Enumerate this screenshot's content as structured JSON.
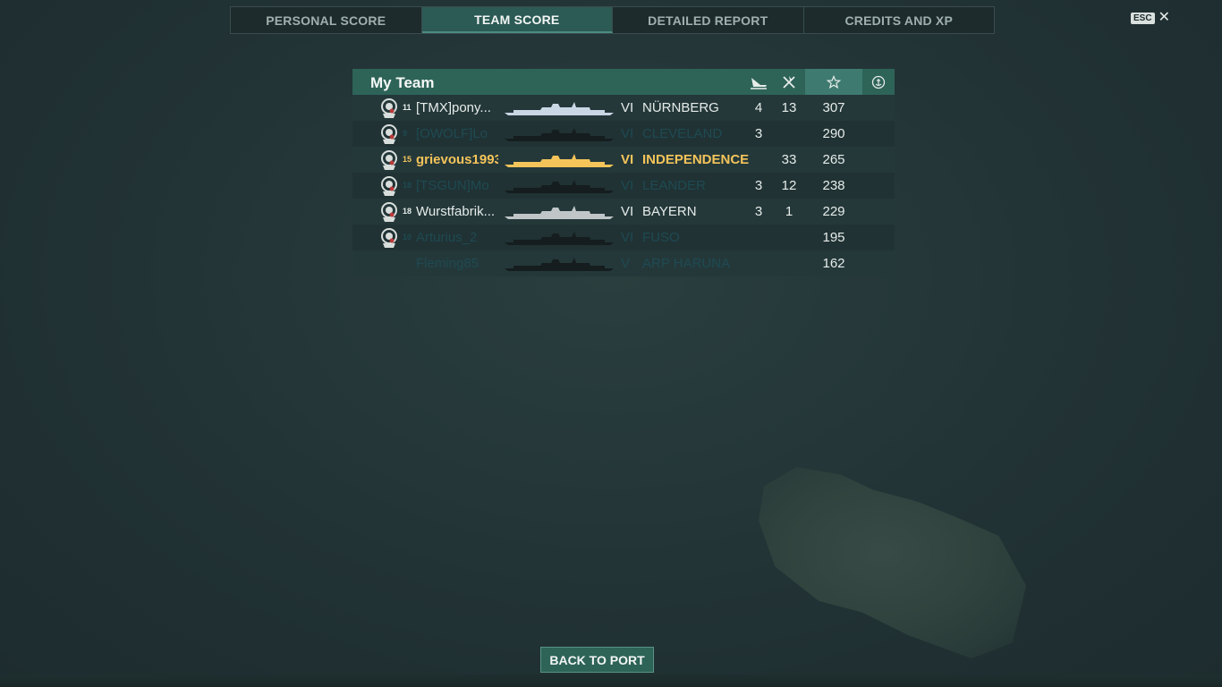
{
  "tabs": [
    {
      "label": "PERSONAL SCORE",
      "active": false
    },
    {
      "label": "TEAM SCORE",
      "active": true
    },
    {
      "label": "DETAILED REPORT",
      "active": false
    },
    {
      "label": "CREDITS AND XP",
      "active": false
    }
  ],
  "close": {
    "key_label": "ESC",
    "icon": "close-icon"
  },
  "team": {
    "title": "My Team",
    "columns": [
      {
        "icon": "ship-sunk-icon"
      },
      {
        "icon": "plane-shot-down-icon"
      },
      {
        "icon": "star-icon"
      },
      {
        "icon": "anchor-icon"
      }
    ],
    "rows": [
      {
        "rank": "11",
        "name": "[TMX]pony...",
        "tier": "VI",
        "ship": "NÜRNBERG",
        "kills": "4",
        "planes": "13",
        "score": "307",
        "state": "alive",
        "silhouette_color": "#c9d6e4"
      },
      {
        "rank": "9",
        "name": "[OWOLF]Lo",
        "tier": "VI",
        "ship": "CLEVELAND",
        "kills": "3",
        "planes": "",
        "score": "290",
        "state": "dead",
        "silhouette_color": "#151d1e"
      },
      {
        "rank": "15",
        "name": "grievous1993",
        "tier": "VI",
        "ship": "INDEPENDENCE",
        "kills": "",
        "planes": "33",
        "score": "265",
        "state": "me",
        "silhouette_color": "#f4c45a"
      },
      {
        "rank": "18",
        "name": "[TSGUN]Mo",
        "tier": "VI",
        "ship": "LEANDER",
        "kills": "3",
        "planes": "12",
        "score": "238",
        "state": "dead",
        "silhouette_color": "#151d1e"
      },
      {
        "rank": "18",
        "name": "Wurstfabrik...",
        "tier": "VI",
        "ship": "BAYERN",
        "kills": "3",
        "planes": "1",
        "score": "229",
        "state": "alive",
        "silhouette_color": "#c0c6c8"
      },
      {
        "rank": "10",
        "name": "Arturius_2",
        "tier": "VI",
        "ship": "FUSO",
        "kills": "",
        "planes": "",
        "score": "195",
        "state": "dead",
        "silhouette_color": "#151d1e"
      },
      {
        "rank": "",
        "name": "Fleming85",
        "tier": "V",
        "ship": "ARP HARUNA",
        "kills": "",
        "planes": "",
        "score": "162",
        "state": "dead",
        "silhouette_color": "#151d1e"
      }
    ]
  },
  "back_button": {
    "label": "BACK TO PORT"
  }
}
